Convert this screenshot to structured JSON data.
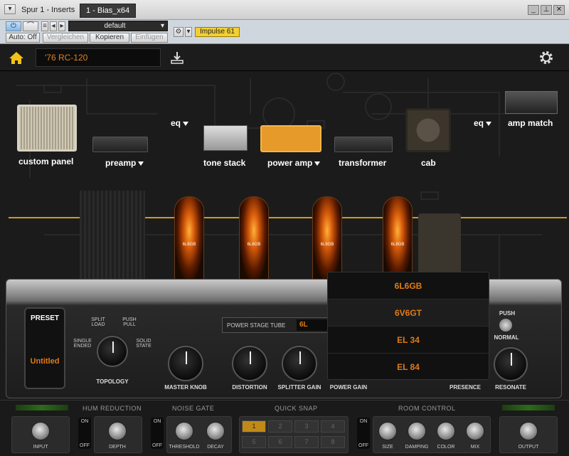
{
  "window": {
    "title": "Spur 1 - Inserts",
    "tab": "1 - Bias_x64",
    "controls": [
      "▾",
      "_",
      "⊥",
      "✕"
    ]
  },
  "toolbar": {
    "preset": "default",
    "auto": "Auto: Off",
    "compare": "Vergleichen",
    "copy": "Kopieren",
    "paste": "Einfügen",
    "impulse": "Impulse 61"
  },
  "app": {
    "preset_name": "'76 RC-120"
  },
  "chain": {
    "custom_panel": "custom panel",
    "preamp": "preamp",
    "eq1": "eq",
    "tone_stack": "tone stack",
    "power_amp": "power amp",
    "transformer": "transformer",
    "cab": "cab",
    "eq2": "eq",
    "amp_match": "amp match"
  },
  "tubes": [
    "6L6GB",
    "6L6GB",
    "6L6GB",
    "6L6GB"
  ],
  "panel": {
    "preset_label": "PRESET",
    "preset_value": "Untitled",
    "split_load": "SPLIT LOAD",
    "push_pull": "PUSH PULL",
    "single_ended": "SINGLE ENDED",
    "solid_state": "SOLID STATE",
    "topology": "TOPOLOGY",
    "master": "MASTER KNOB",
    "distortion": "DISTORTION",
    "splitter": "SPLITTER GAIN",
    "power_gain": "POWER GAIN",
    "presence": "PRESENCE",
    "resonate": "RESONATE",
    "push": "PUSH",
    "normal": "NORMAL",
    "tube_label": "POWER STAGE TUBE",
    "tube_value": "6L"
  },
  "dropdown": [
    "6L6GB",
    "6V6GT",
    "EL 34",
    "EL 84"
  ],
  "strip": {
    "hum": "HUM REDUCTION",
    "gate": "NOISE GATE",
    "snap": "QUICK SNAP",
    "room": "ROOM CONTROL",
    "input": "INPUT",
    "depth": "DEPTH",
    "threshold": "THRESHOLD",
    "decay": "DECAY",
    "size": "SIZE",
    "damping": "DAMPING",
    "color": "COLOR",
    "mix": "MIX",
    "output": "OUTPUT",
    "on": "ON",
    "off": "OFF",
    "snaps": [
      "1",
      "2",
      "3",
      "4",
      "5",
      "6",
      "7",
      "8"
    ]
  },
  "colors": {
    "accent": "#e07b17",
    "chain": "#d49a1c",
    "impulse": "#f2d034"
  }
}
